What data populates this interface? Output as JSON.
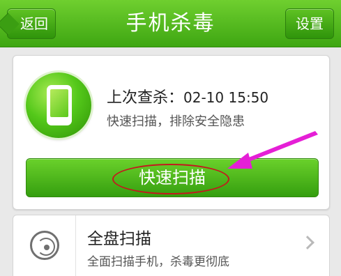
{
  "header": {
    "title": "手机杀毒",
    "back_label": "返回",
    "settings_label": "设置"
  },
  "status": {
    "last_scan_label": "上次查杀：",
    "last_scan_time": "02-10 15:50",
    "subtitle": "快速扫描，排除安全隐患",
    "quick_scan_label": "快速扫描"
  },
  "list": {
    "items": [
      {
        "title": "全盘扫描",
        "subtitle": "全面扫描手机，杀毒更彻底",
        "icon": "radar-icon"
      }
    ]
  },
  "colors": {
    "brand_green": "#3ea612",
    "annotation_red": "#c4181e",
    "annotation_magenta": "#e51fd6"
  }
}
